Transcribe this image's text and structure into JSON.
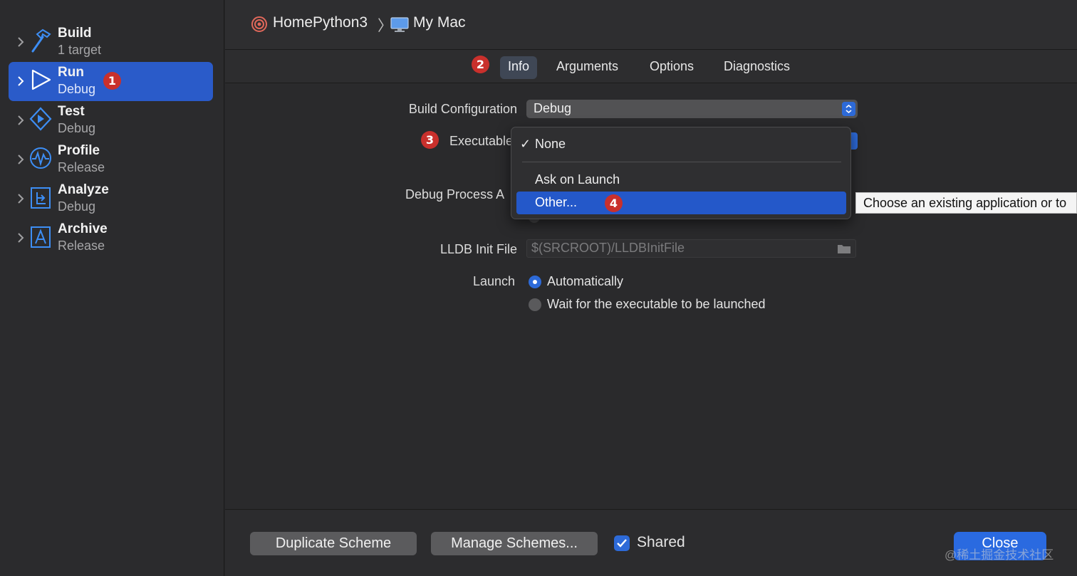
{
  "sidebar": {
    "items": [
      {
        "title": "Build",
        "subtitle": "1 target",
        "icon": "hammer-icon"
      },
      {
        "title": "Run",
        "subtitle": "Debug",
        "icon": "play-icon",
        "selected": true,
        "badge": "1"
      },
      {
        "title": "Test",
        "subtitle": "Debug",
        "icon": "test-diamond-icon"
      },
      {
        "title": "Profile",
        "subtitle": "Release",
        "icon": "waveform-icon"
      },
      {
        "title": "Analyze",
        "subtitle": "Debug",
        "icon": "analyze-icon"
      },
      {
        "title": "Archive",
        "subtitle": "Release",
        "icon": "archive-app-icon"
      }
    ]
  },
  "header": {
    "scheme": "HomePython3",
    "separator": "〉",
    "destination": "My Mac"
  },
  "tabs": {
    "badge": "2",
    "items": [
      "Info",
      "Arguments",
      "Options",
      "Diagnostics"
    ],
    "active": "Info"
  },
  "form": {
    "build_config_label": "Build Configuration",
    "build_config_value": "Debug",
    "executable_badge": "3",
    "executable_label": "Executable",
    "debug_process_label": "Debug Process A",
    "lldb_label": "LLDB Init File",
    "lldb_placeholder": "$(SRCROOT)/LLDBInitFile",
    "launch_label": "Launch",
    "launch_options": [
      "Automatically",
      "Wait for the executable to be launched"
    ],
    "launch_selected": "Automatically"
  },
  "menu": {
    "check": "✓",
    "items": [
      "None",
      "Ask on Launch",
      "Other..."
    ],
    "checked": "None",
    "highlighted": "Other...",
    "badge": "4"
  },
  "tooltip": "Choose an existing application or to",
  "footer": {
    "duplicate_label": "Duplicate Scheme",
    "manage_label": "Manage Schemes...",
    "shared_label": "Shared",
    "shared_checked": true,
    "close_label": "Close"
  },
  "watermark": "@稀土掘金技术社区",
  "colors": {
    "accent": "#2d6ad8",
    "selection": "#2a5bc9",
    "badge": "#c9302c"
  }
}
